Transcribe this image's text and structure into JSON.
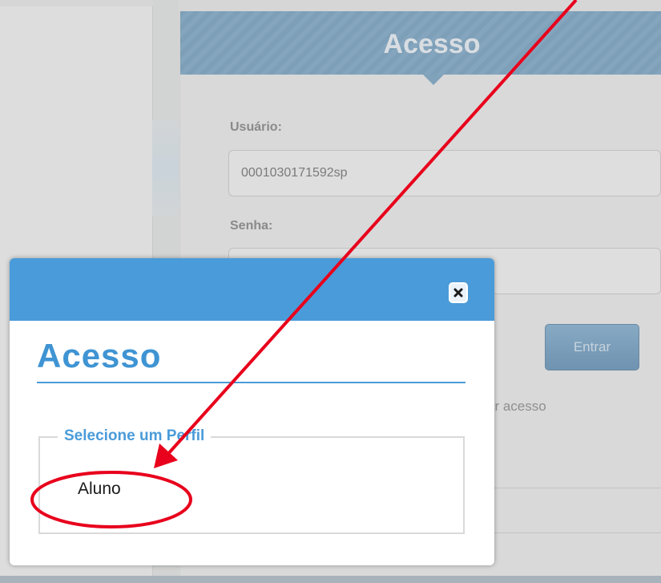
{
  "login": {
    "title": "Acesso",
    "username_label": "Usuário:",
    "username_value": "0001030171592sp",
    "password_label": "Senha:",
    "submit_label": "Entrar",
    "access_link_fragment": "er acesso"
  },
  "modal": {
    "title": "Acesso",
    "close_icon": "close-icon",
    "profile_legend": "Selecione um Perfil",
    "profiles": [
      "Aluno"
    ]
  },
  "colors": {
    "modal_accent": "#4a9bd9",
    "annotation_red": "#e8001c"
  }
}
